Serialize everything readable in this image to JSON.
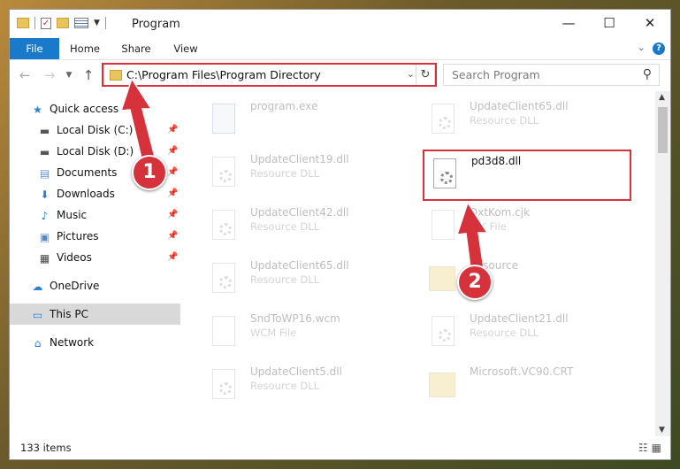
{
  "window": {
    "title": "Program",
    "controls": {
      "minimize": "—",
      "maximize": "☐",
      "close": "✕"
    }
  },
  "ribbon": {
    "tabs": [
      "File",
      "Home",
      "Share",
      "View"
    ],
    "help": "?"
  },
  "address_bar": {
    "path": "C:\\Program Files\\Program Directory",
    "search_placeholder": "Search Program"
  },
  "sidebar": {
    "items": [
      {
        "label": "Quick access",
        "icon": "star-icon"
      },
      {
        "label": "Local Disk (C:)",
        "icon": "drive-icon",
        "pinned": true
      },
      {
        "label": "Local Disk (D:)",
        "icon": "drive-icon",
        "pinned": true
      },
      {
        "label": "Documents",
        "icon": "documents-icon",
        "pinned": true
      },
      {
        "label": "Downloads",
        "icon": "download-icon",
        "pinned": true
      },
      {
        "label": "Music",
        "icon": "music-icon",
        "pinned": true
      },
      {
        "label": "Pictures",
        "icon": "pictures-icon",
        "pinned": true
      },
      {
        "label": "Videos",
        "icon": "video-icon",
        "pinned": true
      },
      {
        "label": "OneDrive",
        "icon": "cloud-icon"
      },
      {
        "label": "This PC",
        "icon": "computer-icon",
        "selected": true
      },
      {
        "label": "Network",
        "icon": "network-icon"
      }
    ]
  },
  "files": [
    {
      "name": "program.exe",
      "type": "",
      "icon": "exe-icon"
    },
    {
      "name": "UpdateClient65.dll",
      "type": "Resource DLL",
      "icon": "dll-icon"
    },
    {
      "name": "UpdateClient19.dll",
      "type": "Resource DLL",
      "icon": "dll-icon"
    },
    {
      "name": "pd3d8.dll",
      "type": "",
      "icon": "dll-icon",
      "highlighted": true
    },
    {
      "name": "UpdateClient42.dll",
      "type": "Resource DLL",
      "icon": "dll-icon"
    },
    {
      "name": "DxtKom.cjk",
      "type": "CJK File",
      "icon": "file-icon"
    },
    {
      "name": "UpdateClient65.dll",
      "type": "Resource DLL",
      "icon": "dll-icon"
    },
    {
      "name": "Resource",
      "type": "",
      "icon": "folder-icon"
    },
    {
      "name": "SndToWP16.wcm",
      "type": "WCM File",
      "icon": "file-icon"
    },
    {
      "name": "UpdateClient21.dll",
      "type": "Resource DLL",
      "icon": "dll-icon"
    },
    {
      "name": "UpdateClient5.dll",
      "type": "Resource DLL",
      "icon": "dll-icon"
    },
    {
      "name": "Microsoft.VC90.CRT",
      "type": "",
      "icon": "folder-icon"
    }
  ],
  "annotations": {
    "step1": "1",
    "step2": "2"
  },
  "status": {
    "items": "133 items"
  },
  "colors": {
    "accent": "#1979ca",
    "highlight": "#d9303b"
  }
}
